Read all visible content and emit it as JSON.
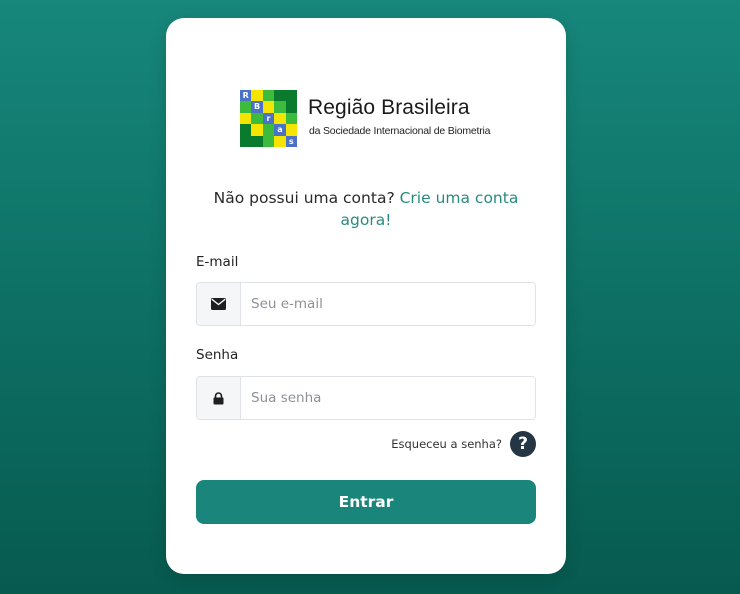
{
  "brand": {
    "title": "Região Brasileira",
    "subtitle": "da Sociedade Internacional de Biometria",
    "logo_letters": [
      "R",
      "B",
      "r",
      "a",
      "s"
    ],
    "colors": {
      "yellow": "#f5e400",
      "light_green": "#3dbb3d",
      "dark_green": "#0a7a2c",
      "blue": "#4a73c7"
    }
  },
  "signup_prompt": {
    "text": "Não possui uma conta?",
    "link_label": "Crie uma conta agora!"
  },
  "email": {
    "label": "E-mail",
    "placeholder": "Seu e-mail",
    "value": "",
    "icon": "envelope-icon"
  },
  "password": {
    "label": "Senha",
    "placeholder": "Sua senha",
    "value": "",
    "icon": "lock-icon"
  },
  "forgot": {
    "label": "Esqueceu a senha?",
    "icon": "question-circle-icon"
  },
  "submit": {
    "label": "Entrar",
    "color": "#1a857a"
  },
  "theme": {
    "background_top": "#17877b",
    "background_bottom": "#075a4f",
    "link_color": "#2a8a7f"
  }
}
